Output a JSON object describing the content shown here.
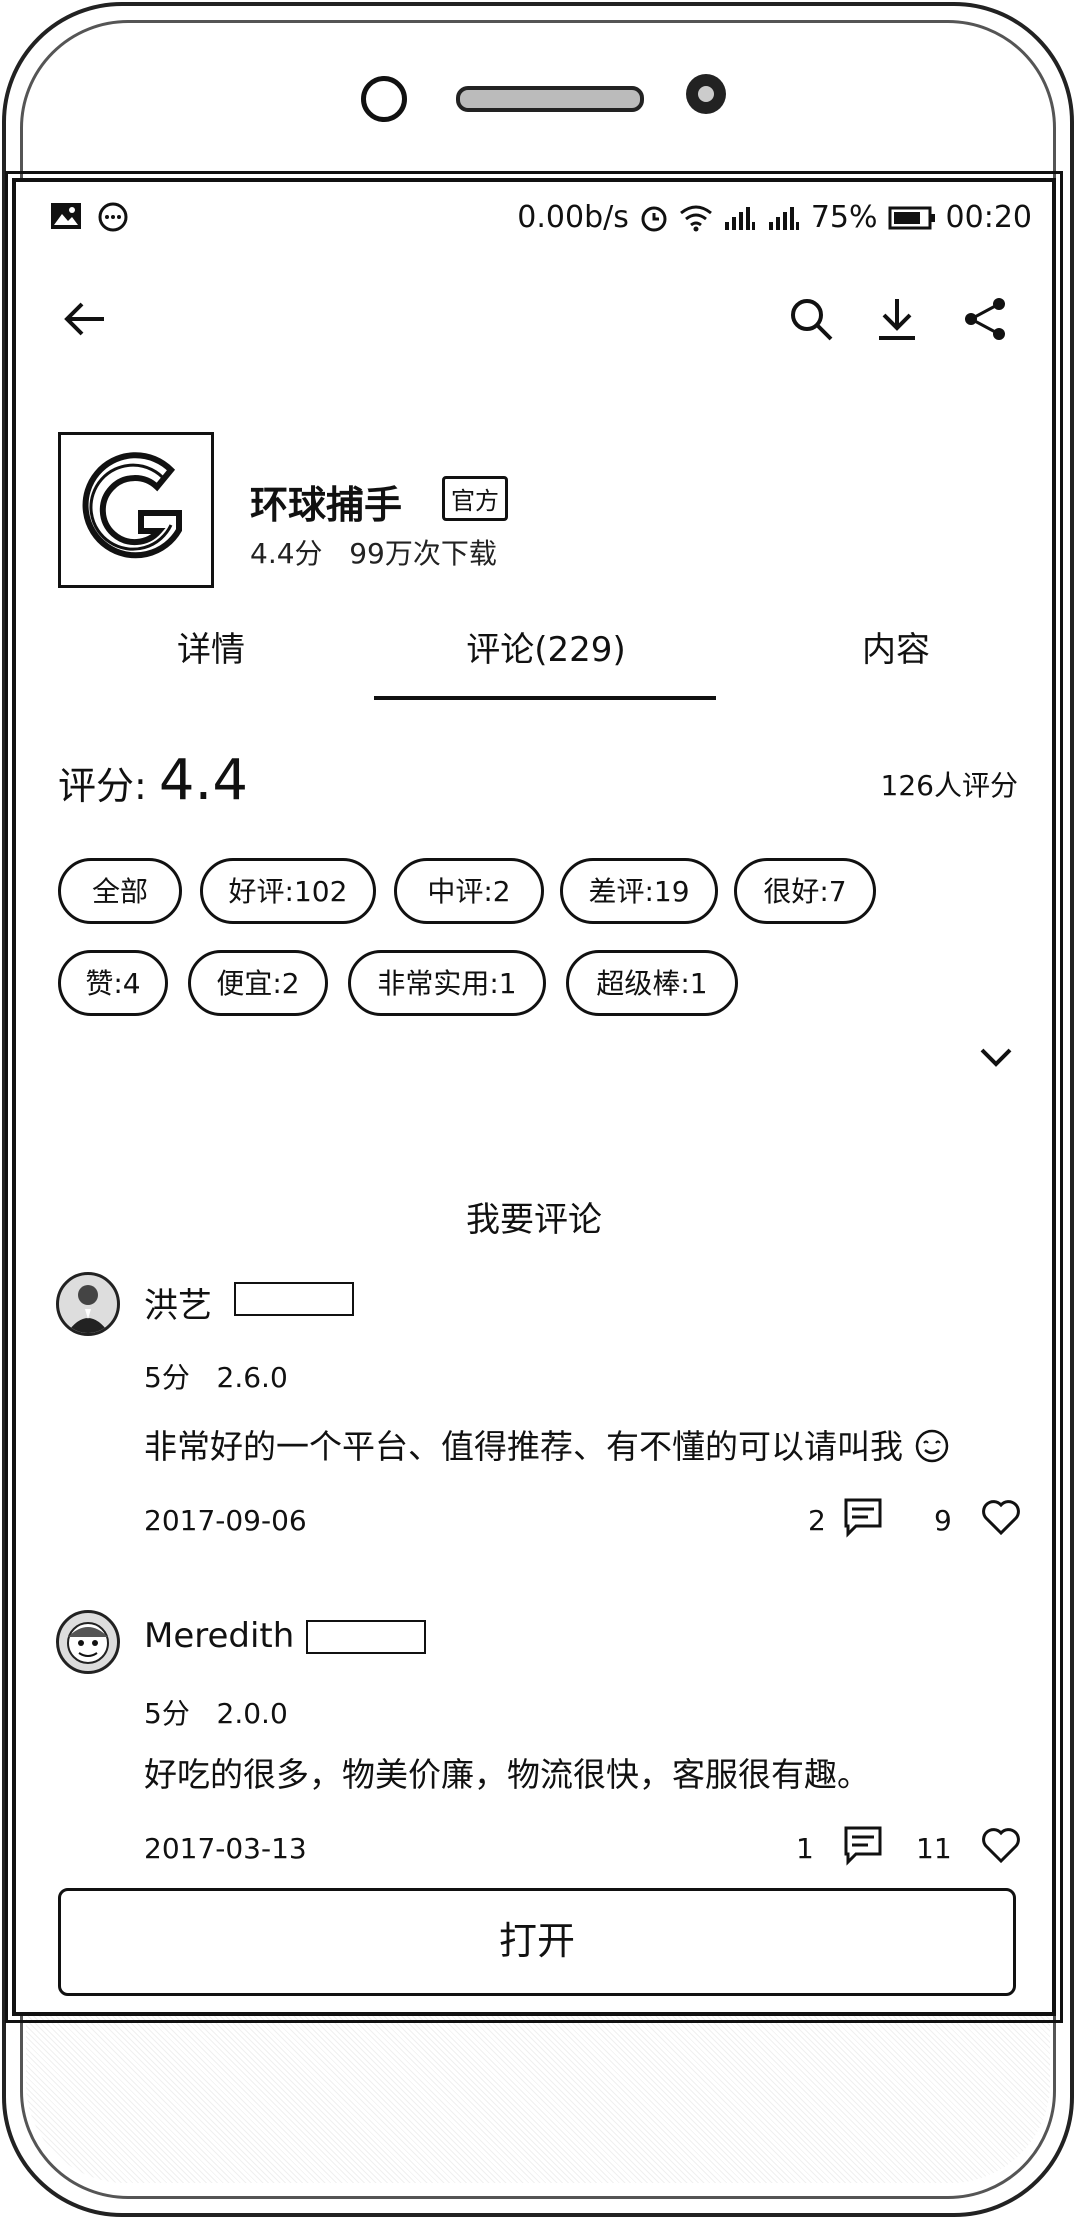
{
  "status": {
    "speed": "0.00b/s",
    "battery": "75%",
    "time": "00:20"
  },
  "app": {
    "name": "环球捕手",
    "official_badge": "官方",
    "rating": "4.4分",
    "downloads": "99万次下载"
  },
  "tabs": [
    {
      "label": "详情"
    },
    {
      "label": "评论(229)"
    },
    {
      "label": "内容"
    }
  ],
  "score": {
    "label": "评分:",
    "value": "4.4",
    "raters": "126人评分"
  },
  "filters": [
    {
      "label": "全部"
    },
    {
      "label": "好评:102"
    },
    {
      "label": "中评:2"
    },
    {
      "label": "差评:19"
    },
    {
      "label": "很好:7"
    },
    {
      "label": "赞:4"
    },
    {
      "label": "便宜:2"
    },
    {
      "label": "非常实用:1"
    },
    {
      "label": "超级棒:1"
    }
  ],
  "write_comment": "我要评论",
  "reviews": [
    {
      "user": "洪艺",
      "score": "5分",
      "version": "2.6.0",
      "text": "非常好的一个平台、值得推荐、有不懂的可以请叫我",
      "date": "2017-09-06",
      "replies": "2",
      "likes": "9"
    },
    {
      "user": "Meredith",
      "score": "5分",
      "version": "2.0.0",
      "text": "好吃的很多，物美价廉，物流很快，客服很有趣。",
      "date": "2017-03-13",
      "replies": "1",
      "likes": "11"
    }
  ],
  "open_button": "打开"
}
